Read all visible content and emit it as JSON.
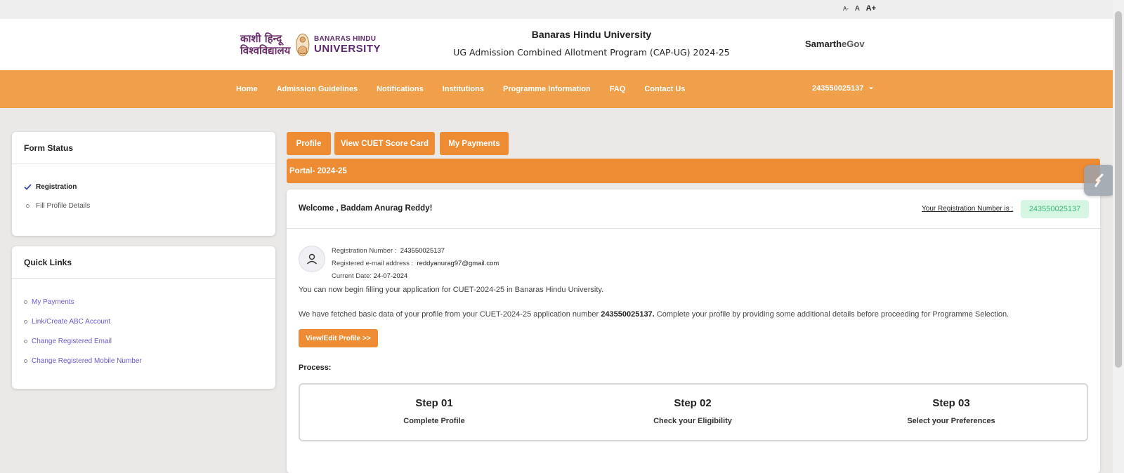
{
  "font_sizes": {
    "small": "A-",
    "normal": "A",
    "large": "A+"
  },
  "header": {
    "logo": {
      "hindi_line1": "काशी हिन्दू",
      "hindi_line2": "विश्वविद्यालय",
      "eng_line1": "BANARAS HINDU",
      "eng_line2": "UNIVERSITY"
    },
    "title": "Banaras Hindu University",
    "subtitle": "UG Admission Combined Allotment Program (CAP-UG) 2024-25",
    "brand_main": "Samarth",
    "brand_suffix": "eGov"
  },
  "nav": {
    "items": [
      "Home",
      "Admission Guidelines",
      "Notifications",
      "Institutions",
      "Programme Information",
      "FAQ",
      "Contact Us"
    ],
    "user": "243550025137"
  },
  "form_status": {
    "title": "Form Status",
    "items": [
      {
        "label": "Registration",
        "done": true
      },
      {
        "label": "Fill Profile Details",
        "done": false
      }
    ]
  },
  "quick_links": {
    "title": "Quick Links",
    "items": [
      "My Payments",
      "Link/Create ABC Account",
      "Change Registered Email",
      "Change Registered Mobile Number"
    ]
  },
  "tabs": [
    "Profile",
    "View CUET Score Card",
    "My Payments"
  ],
  "marquee": "Portal- 2024-25",
  "welcome": {
    "greeting": "Welcome , Baddam Anurag Reddy!",
    "reg_label": "Your Registration Number is :",
    "reg_number": "243550025137"
  },
  "profile": {
    "reg_label": "Registration Number :",
    "reg_value": "243550025137",
    "email_label": "Registered e-mail address :",
    "email_value": "reddyanurag97@gmail.com",
    "date_label": "Current Date:",
    "date_value": "24-07-2024"
  },
  "messages": {
    "line1": "You can now begin filling your application for CUET-2024-25 in Banaras Hindu University.",
    "line2_pre": "We have fetched basic data of your profile from your CUET-2024-25 application number",
    "line2_num": "243550025137.",
    "line2_post": "Complete your profile by providing some additional details before proceeding for Programme Selection."
  },
  "edit_button": "View/Edit Profile >>",
  "process": {
    "label": "Process:",
    "steps": [
      {
        "title": "Step 01",
        "desc": "Complete Profile"
      },
      {
        "title": "Step 02",
        "desc": "Check your Eligibility"
      },
      {
        "title": "Step 03",
        "desc": "Select your Preferences"
      }
    ]
  },
  "colors": {
    "nav_bg": "#f0a04b",
    "accent": "#ee8c33",
    "badge_bg": "#d6f5e3",
    "badge_text": "#3cb878",
    "link": "#6a5acd"
  }
}
